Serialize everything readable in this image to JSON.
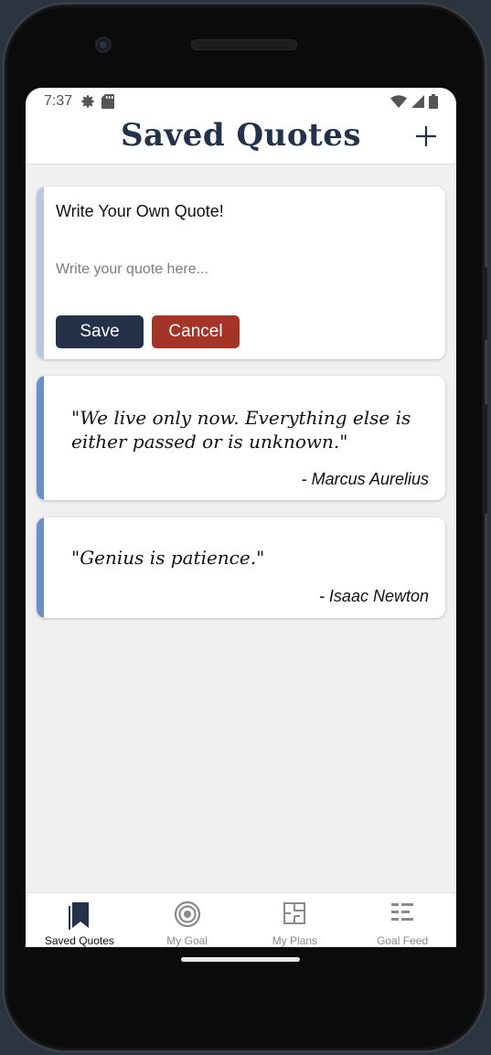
{
  "status_bar": {
    "time": "7:37",
    "icons_left": [
      "settings-gear-icon",
      "sd-card-icon"
    ],
    "icons_right": [
      "wifi-icon",
      "cell-signal-icon",
      "battery-icon"
    ]
  },
  "header": {
    "title": "Saved Quotes",
    "add_icon": "plus-icon"
  },
  "compose": {
    "title": "Write Your Own Quote!",
    "placeholder": "Write your quote here...",
    "value": "",
    "save_label": "Save",
    "cancel_label": "Cancel"
  },
  "quotes": [
    {
      "text": "\"We live only now. Everything else is either passed or is unknown.\"",
      "author": "- Marcus Aurelius"
    },
    {
      "text": "\"Genius is patience.\"",
      "author": "- Isaac Newton"
    }
  ],
  "bottom_nav": [
    {
      "label": "Saved Quotes",
      "icon": "bookmarks-icon",
      "active": true
    },
    {
      "label": "My Goal",
      "icon": "target-icon",
      "active": false
    },
    {
      "label": "My Plans",
      "icon": "floorplan-icon",
      "active": false
    },
    {
      "label": "Goal Feed",
      "icon": "feed-list-icon",
      "active": false
    }
  ],
  "colors": {
    "primary": "#253149",
    "danger": "#a33426",
    "accent": "#6b8fc7",
    "background": "#f0f0f0"
  }
}
